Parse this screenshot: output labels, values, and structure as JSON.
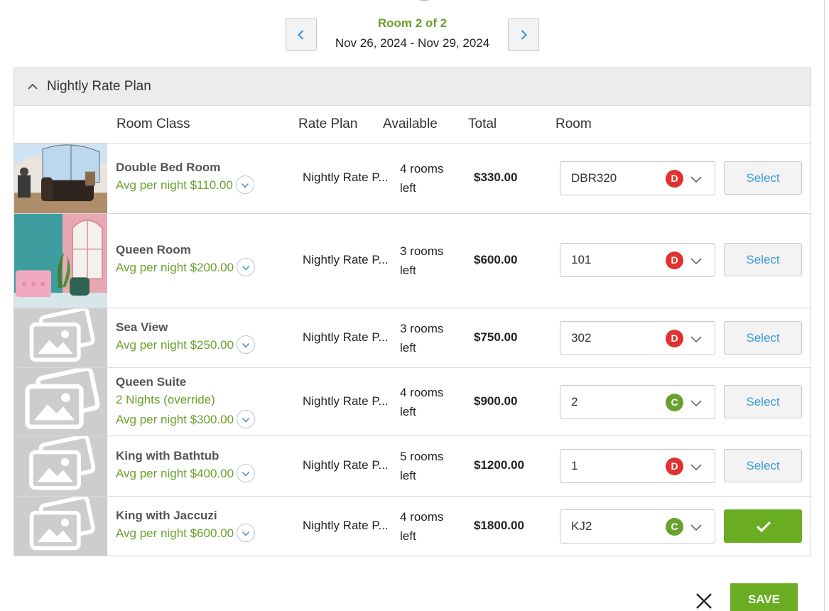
{
  "header": {
    "room_count": "Room 2 of 2",
    "date_range": "Nov 26, 2024 - Nov 29, 2024"
  },
  "panel": {
    "title": "Nightly Rate Plan"
  },
  "columns": {
    "room_class": "Room Class",
    "rate_plan": "Rate Plan",
    "available": "Available",
    "total": "Total",
    "room": "Room"
  },
  "rows": [
    {
      "name": "Double Bed Room",
      "override": "",
      "avg": "Avg per night $110.00",
      "rate_plan": "Nightly Rate P...",
      "avail_line1": "4 rooms",
      "avail_line2": "left",
      "total": "$330.00",
      "room": "DBR320",
      "badge": "D",
      "action": "Select"
    },
    {
      "name": "Queen Room",
      "override": "",
      "avg": "Avg per night $200.00",
      "rate_plan": "Nightly Rate P...",
      "avail_line1": "3 rooms",
      "avail_line2": "left",
      "total": "$600.00",
      "room": "101",
      "badge": "D",
      "action": "Select"
    },
    {
      "name": "Sea View",
      "override": "",
      "avg": "Avg per night $250.00",
      "rate_plan": "Nightly Rate P...",
      "avail_line1": "3 rooms",
      "avail_line2": "left",
      "total": "$750.00",
      "room": "302",
      "badge": "D",
      "action": "Select"
    },
    {
      "name": "Queen Suite",
      "override": "2 Nights (override)",
      "avg": "Avg per night $300.00",
      "rate_plan": "Nightly Rate P...",
      "avail_line1": "4 rooms",
      "avail_line2": "left",
      "total": "$900.00",
      "room": "2",
      "badge": "C",
      "action": "Select"
    },
    {
      "name": "King with Bathtub",
      "override": "",
      "avg": "Avg per night $400.00",
      "rate_plan": "Nightly Rate P...",
      "avail_line1": "5 rooms",
      "avail_line2": "left",
      "total": "$1200.00",
      "room": "1",
      "badge": "D",
      "action": "Select"
    },
    {
      "name": "King with Jaccuzi",
      "override": "",
      "avg": "Avg per night $600.00",
      "rate_plan": "Nightly Rate P...",
      "avail_line1": "4 rooms",
      "avail_line2": "left",
      "total": "$1800.00",
      "room": "KJ2",
      "badge": "C",
      "action": "selected-check"
    }
  ],
  "footer": {
    "save_label": "SAVE"
  },
  "colors": {
    "accent_green": "#6aad22",
    "link_blue": "#3d9bd9",
    "badge_red": "#e0322f"
  }
}
